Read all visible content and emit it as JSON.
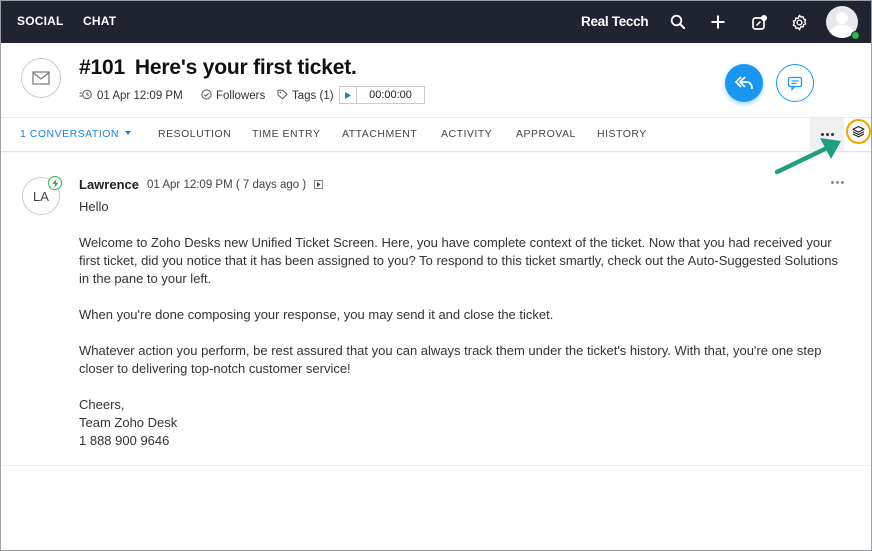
{
  "topbar": {
    "nav": [
      "SOCIAL",
      "CHAT"
    ],
    "brand": "Real Tecch",
    "icons": [
      "search-icon",
      "plus-icon",
      "edit-icon",
      "gear-icon",
      "avatar"
    ]
  },
  "ticket": {
    "number": "#101",
    "title": "Here's your first ticket.",
    "date": "01 Apr 12:09 PM",
    "followers_label": "Followers",
    "tags_label": "Tags (1)",
    "timer": "00:00:00"
  },
  "tabs": {
    "items": [
      {
        "label": "1 CONVERSATION",
        "active": true
      },
      {
        "label": "RESOLUTION",
        "active": false
      },
      {
        "label": "TIME ENTRY",
        "active": false
      },
      {
        "label": "ATTACHMENT",
        "active": false
      },
      {
        "label": "ACTIVITY",
        "active": false
      },
      {
        "label": "APPROVAL",
        "active": false
      },
      {
        "label": "HISTORY",
        "active": false
      }
    ]
  },
  "thread": {
    "avatar_initials": "LA",
    "sender": "Lawrence",
    "time": "01 Apr 12:09 PM ( 7 days ago )",
    "greeting": "Hello",
    "paragraph1_line1": "Welcome to Zoho Desks new Unified Ticket Screen. Here, you have complete context of the ticket. Now that you had received your",
    "paragraph1_line2": "first ticket, did you notice that it has been assigned to you? To respond to this ticket smartly, check out the Auto-Suggested Solutions",
    "paragraph1_line3": "in the pane to your left.",
    "paragraph2": "When you're done composing your response, you may send it and close the ticket.",
    "paragraph3_line1": "Whatever action you perform, be rest assured that you can always track them under the ticket's history. With that, you're one step",
    "paragraph3_line2": "closer to delivering top-notch customer service!",
    "sign_off": "Cheers,",
    "signature": "Team Zoho Desk",
    "phone": "1 888 900 9646"
  },
  "colors": {
    "topbar_bg": "#1f2430",
    "accent": "#1a96f0",
    "highlight_ring": "#f0a400",
    "arrow": "#1f9e80",
    "online": "#2fb24c"
  }
}
